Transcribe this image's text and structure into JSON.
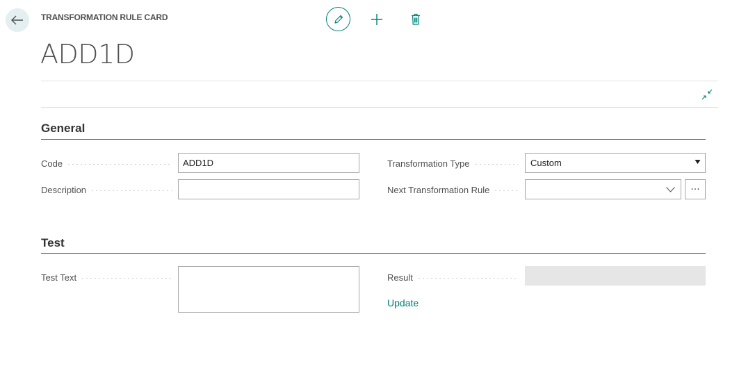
{
  "header": {
    "caption": "TRANSFORMATION RULE CARD",
    "title": "ADD1D"
  },
  "icons": {
    "back": "arrow-left-icon",
    "edit": "pencil-icon",
    "new": "plus-icon",
    "delete": "trash-icon",
    "collapse": "collapse-arrows-icon",
    "dropdown": "chevron-down-icon",
    "more": "ellipsis-icon"
  },
  "colors": {
    "accent": "#00807a",
    "back_button_bg": "#e3eff0",
    "readonly_bg": "#e6e6e6"
  },
  "general": {
    "title": "General",
    "code_label": "Code",
    "code_value": "ADD1D",
    "description_label": "Description",
    "description_value": "",
    "transformation_type_label": "Transformation Type",
    "transformation_type_value": "Custom",
    "next_rule_label": "Next Transformation Rule",
    "next_rule_value": "",
    "more_button_label": "···"
  },
  "test": {
    "title": "Test",
    "test_text_label": "Test Text",
    "test_text_value": "",
    "result_label": "Result",
    "result_value": "",
    "update_link": "Update"
  }
}
